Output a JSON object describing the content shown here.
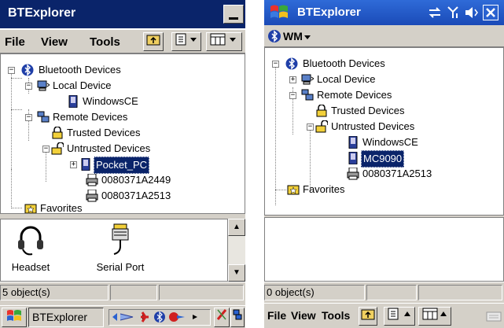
{
  "left": {
    "title": "BTExplorer",
    "menu": [
      "File",
      "View",
      "Tools"
    ],
    "tree": {
      "root": "Bluetooth Devices",
      "local_device": "Local Device",
      "local_child": "WindowsCE",
      "remote_devices": "Remote Devices",
      "trusted": "Trusted Devices",
      "untrusted": "Untrusted Devices",
      "devices": [
        "Pocket_PC",
        "0080371A2449",
        "0080371A2513"
      ],
      "favorites": "Favorites"
    },
    "services": [
      "Headset",
      "Serial Port"
    ],
    "status": "5 object(s)",
    "taskbar_app": "BTExplorer"
  },
  "right": {
    "title": "BTExplorer",
    "wm_label": "WM",
    "tree": {
      "root": "Bluetooth Devices",
      "local_device": "Local Device",
      "remote_devices": "Remote Devices",
      "trusted": "Trusted Devices",
      "untrusted": "Untrusted Devices",
      "devices": [
        "WindowsCE",
        "MC9090",
        "0080371A2513"
      ],
      "favorites": "Favorites"
    },
    "status": "0 object(s)",
    "menu": [
      "File",
      "View",
      "Tools"
    ]
  },
  "colors": {
    "selection": "#0a246a",
    "title_left": "#0a246a",
    "title_right": "#1f57c9",
    "chrome": "#d4d0c8"
  }
}
